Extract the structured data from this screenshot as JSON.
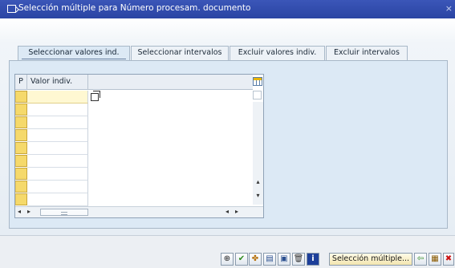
{
  "window": {
    "title": "Selección múltiple para Número procesam. documento",
    "close_glyph": "×"
  },
  "tabs": [
    {
      "label": "Seleccionar valores ind.",
      "active": true
    },
    {
      "label": "Seleccionar intervalos",
      "active": false
    },
    {
      "label": "Excluir valores indiv.",
      "active": false
    },
    {
      "label": "Excluir intervalos",
      "active": false
    }
  ],
  "table": {
    "columns": [
      "P",
      "Valor indiv."
    ],
    "rows": [
      "",
      "",
      "",
      "",
      "",
      "",
      "",
      "",
      ""
    ]
  },
  "scroll": {
    "left": "◂",
    "right": "▸",
    "up": "▴",
    "down": "▾"
  },
  "toolbar": {
    "buttons": [
      {
        "icon": "execute-icon",
        "glyph": "⊕",
        "color": "#1b1b1b"
      },
      {
        "icon": "checkmark-icon",
        "glyph": "✔",
        "color": "#2e8b1e"
      },
      {
        "icon": "multi-select-icon",
        "glyph": "✤",
        "color": "#b36b00"
      },
      {
        "icon": "insert-row-icon",
        "glyph": "▤",
        "color": "#2a4f8f"
      },
      {
        "icon": "delete-row-icon",
        "glyph": "▣",
        "color": "#2a4f8f"
      },
      {
        "icon": "delete-icon",
        "glyph": "🗑",
        "color": "#333333"
      },
      {
        "icon": "info-icon",
        "glyph": "i",
        "color": "#ffffff"
      },
      {
        "icon": "import-icon",
        "glyph": "⇦",
        "color": "#2e8b1e"
      },
      {
        "icon": "clipboard-icon",
        "glyph": "▦",
        "color": "#8a5a00"
      },
      {
        "icon": "cancel-icon",
        "glyph": "✖",
        "color": "#cc1111"
      }
    ],
    "multi_select_label": "Selección múltiple..."
  }
}
